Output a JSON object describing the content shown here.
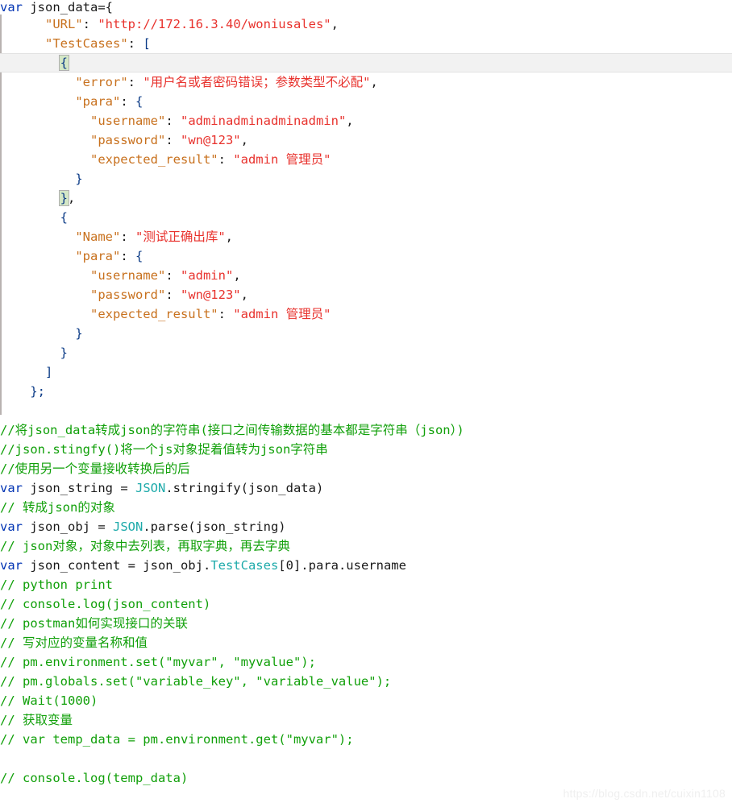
{
  "editor": {
    "language": "javascript",
    "watermark": "https://blog.csdn.net/cuixin1108",
    "colors": {
      "background": "#ffffff",
      "keyword": "#0033b3",
      "property": "#c8711e",
      "string": "#e8322d",
      "comment": "#11a00a",
      "class": "#1eaaaa",
      "punctuation": "#1a1a1a",
      "current_line": "#f2f2f2",
      "bracket_match": "#d4e7c6",
      "watermark": "#efefef"
    }
  },
  "code": {
    "l1_var": "var",
    "l1_rest": " json_data={",
    "l2_key": "\"URL\"",
    "l2_colon": ": ",
    "l2_val": "\"http://172.16.3.40/woniusales\"",
    "l2_comma": ",",
    "l3_key": "\"TestCases\"",
    "l3_colon": ": ",
    "l3_brk": "[",
    "l4_brace": "{",
    "l5_key": "\"error\"",
    "l5_colon": ": ",
    "l5_val": "\"用户名或者密码错误；参数类型不必配\"",
    "l5_comma": ",",
    "l6_key": "\"para\"",
    "l6_colon": ": ",
    "l6_brace": "{",
    "l7_key": "\"username\"",
    "l7_colon": ": ",
    "l7_val": "\"adminadminadminadmin\"",
    "l7_comma": ",",
    "l8_key": "\"password\"",
    "l8_colon": ": ",
    "l8_val": "\"wn@123\"",
    "l8_comma": ",",
    "l9_key": "\"expected_result\"",
    "l9_colon": ": ",
    "l9_val": "\"admin 管理员\"",
    "l10_brace": "}",
    "l11_brace": "}",
    "l11_comma": ",",
    "l12_brace": "{",
    "l13_key": "\"Name\"",
    "l13_colon": ": ",
    "l13_val": "\"测试正确出库\"",
    "l13_comma": ",",
    "l14_key": "\"para\"",
    "l14_colon": ": ",
    "l14_brace": "{",
    "l15_key": "\"username\"",
    "l15_colon": ": ",
    "l15_val": "\"admin\"",
    "l15_comma": ",",
    "l16_key": "\"password\"",
    "l16_colon": ": ",
    "l16_val": "\"wn@123\"",
    "l16_comma": ",",
    "l17_key": "\"expected_result\"",
    "l17_colon": ": ",
    "l17_val": "\"admin 管理员\"",
    "l18_brace": "}",
    "l19_brace": "}",
    "l20_brk": "]",
    "l21_end": "};",
    "c1": "//将json_data转成json的字符串(接口之间传输数据的基本都是字符串（json）)",
    "c2": "//json.stingfy()将一个js对象捉着值转为json字符串",
    "c3": "//使用另一个变量接收转换后的后",
    "l25_var": "var",
    "l25_mid": " json_string = ",
    "l25_cls": "JSON",
    "l25_rest": ".stringify(json_data)",
    "c4": "// 转成json的对象",
    "l27_var": "var",
    "l27_mid": " json_obj = ",
    "l27_cls": "JSON",
    "l27_rest": ".parse(json_string)",
    "c5": "// json对象，对象中去列表，再取字典，再去字典",
    "l29_var": "var",
    "l29_mid": " json_content = json_obj.",
    "l29_cls": "TestCases",
    "l29_rest": "[0].para.username",
    "c6": "// python print",
    "c7": "// console.log(json_content)",
    "c8": "// postman如何实现接口的关联",
    "c9": "// 写对应的变量名称和值",
    "c10": "// pm.environment.set(\"myvar\", \"myvalue\");",
    "c11": "// pm.globals.set(\"variable_key\", \"variable_value\");",
    "c12": "// Wait(1000)",
    "c13": "// 获取变量",
    "c14": "// var temp_data = pm.environment.get(\"myvar\");",
    "c15": "",
    "c16": "// console.log(temp_data)"
  }
}
